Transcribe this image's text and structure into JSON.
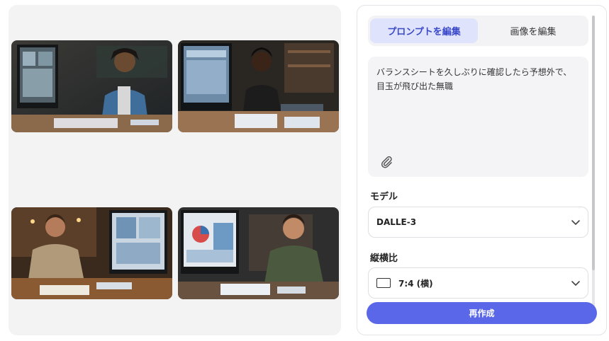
{
  "tabs": {
    "edit_prompt": "プロンプトを編集",
    "edit_image": "画像を編集"
  },
  "prompt": {
    "text": "バランスシートを久しぶりに確認したら予想外で、目玉が飛び出た無職"
  },
  "model": {
    "label": "モデル",
    "selected": "DALLE-3"
  },
  "aspect_ratio": {
    "label": "縦横比",
    "selected": "7:4 (横)"
  },
  "actions": {
    "regenerate": "再作成"
  },
  "icons": {
    "attach": "paperclip-icon",
    "dropdown": "chevron-down-icon",
    "ratio": "landscape-ratio-icon"
  },
  "colors": {
    "accent": "#5a67e8",
    "tab_active_bg": "#dfe3fb",
    "tab_active_text": "#3a49c9"
  }
}
